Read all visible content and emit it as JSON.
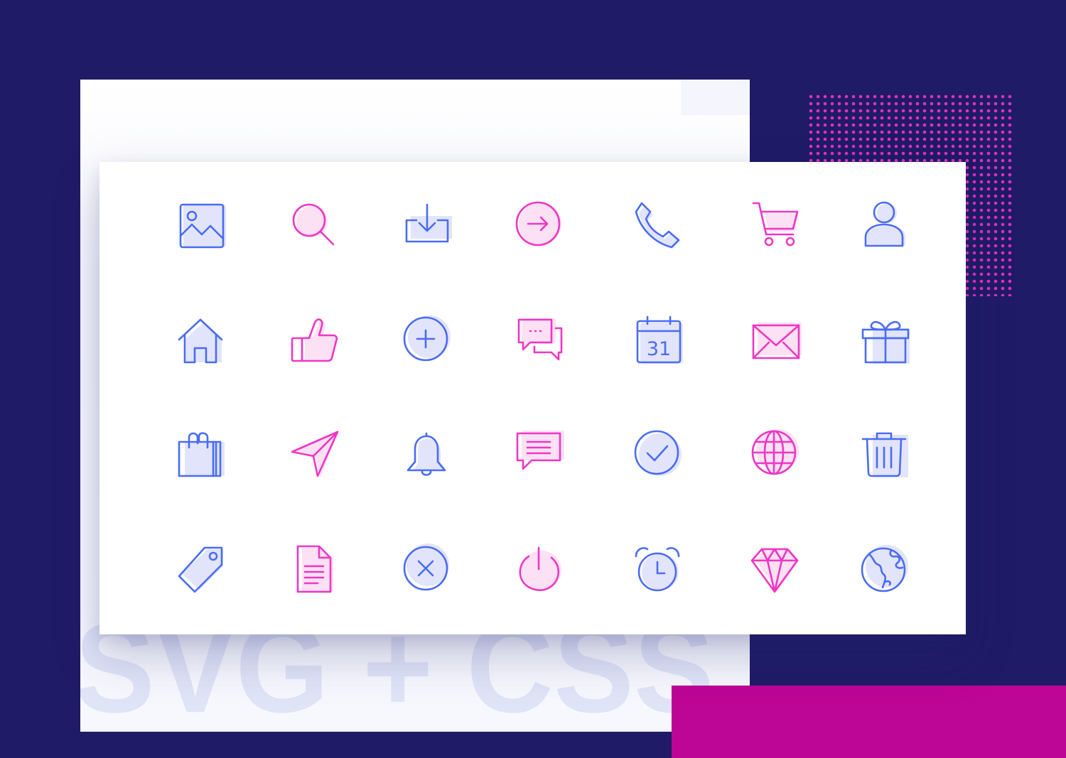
{
  "background_text": "SVG + CSS",
  "colors": {
    "page_background": "#1f1b66",
    "blue": "#4a6cf4",
    "pink": "#ee36c6",
    "magenta_block": "#bd0596",
    "dots": "#e52fc0"
  },
  "calendar_day": "31",
  "icons": [
    {
      "name": "image-icon",
      "color": "blue"
    },
    {
      "name": "search-icon",
      "color": "pink"
    },
    {
      "name": "download-icon",
      "color": "blue"
    },
    {
      "name": "arrow-right-circle-icon",
      "color": "pink"
    },
    {
      "name": "phone-icon",
      "color": "blue"
    },
    {
      "name": "shopping-cart-icon",
      "color": "pink"
    },
    {
      "name": "user-icon",
      "color": "blue"
    },
    {
      "name": "home-icon",
      "color": "blue"
    },
    {
      "name": "thumbs-up-icon",
      "color": "pink"
    },
    {
      "name": "plus-circle-icon",
      "color": "blue"
    },
    {
      "name": "chat-bubbles-icon",
      "color": "pink"
    },
    {
      "name": "calendar-icon",
      "color": "blue"
    },
    {
      "name": "mail-icon",
      "color": "pink"
    },
    {
      "name": "gift-icon",
      "color": "blue"
    },
    {
      "name": "shopping-bag-icon",
      "color": "blue"
    },
    {
      "name": "send-icon",
      "color": "pink"
    },
    {
      "name": "bell-icon",
      "color": "blue"
    },
    {
      "name": "message-icon",
      "color": "pink"
    },
    {
      "name": "check-circle-icon",
      "color": "blue"
    },
    {
      "name": "globe-icon",
      "color": "pink"
    },
    {
      "name": "trash-icon",
      "color": "blue"
    },
    {
      "name": "tag-icon",
      "color": "blue"
    },
    {
      "name": "document-icon",
      "color": "pink"
    },
    {
      "name": "close-circle-icon",
      "color": "blue"
    },
    {
      "name": "power-icon",
      "color": "pink"
    },
    {
      "name": "alarm-clock-icon",
      "color": "blue"
    },
    {
      "name": "diamond-icon",
      "color": "pink"
    },
    {
      "name": "earth-icon",
      "color": "blue"
    }
  ]
}
